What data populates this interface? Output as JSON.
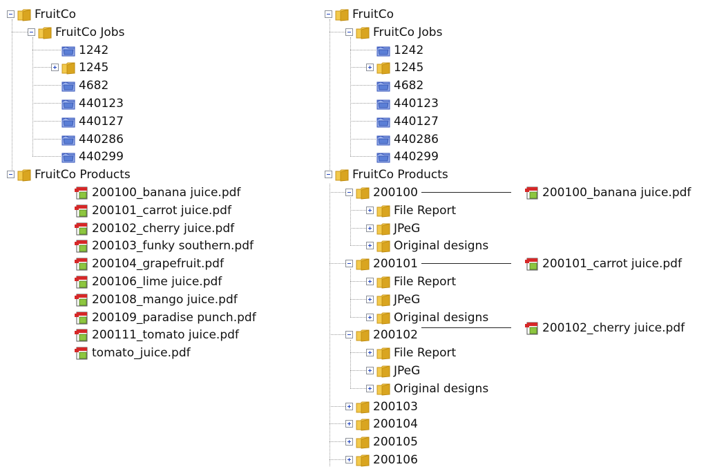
{
  "left_tree": {
    "root": "FruitCo",
    "jobs": {
      "label": "FruitCo Jobs",
      "items": [
        "1242",
        "1245",
        "4682",
        "440123",
        "440127",
        "440286",
        "440299"
      ]
    },
    "products": {
      "label": "FruitCo Products",
      "files": [
        "200100_banana juice.pdf",
        "200101_carrot juice.pdf",
        "200102_cherry juice.pdf",
        "200103_funky southern.pdf",
        "200104_grapefruit.pdf",
        "200106_lime juice.pdf",
        "200108_mango juice.pdf",
        "200109_paradise punch.pdf",
        "200111_tomato juice.pdf",
        "tomato_juice.pdf"
      ]
    }
  },
  "right_tree": {
    "root": "FruitCo",
    "jobs": {
      "label": "FruitCo Jobs",
      "items": [
        "1242",
        "1245",
        "4682",
        "440123",
        "440127",
        "440286",
        "440299"
      ]
    },
    "products": {
      "label": "FruitCo Products",
      "groups": [
        {
          "label": "200100",
          "sub": [
            "File Report",
            "JPeG",
            "Original designs"
          ],
          "file": "200100_banana juice.pdf"
        },
        {
          "label": "200101",
          "sub": [
            "File Report",
            "JPeG",
            "Original designs"
          ],
          "file": "200101_carrot juice.pdf"
        },
        {
          "label": "200102",
          "sub": [
            "File Report",
            "JPeG",
            "Original designs"
          ],
          "file": "200102_cherry juice.pdf"
        }
      ],
      "collapsed": [
        "200103",
        "200104",
        "200105",
        "200106"
      ]
    }
  },
  "colors": {
    "folder": "#f2c94c",
    "folder_dark": "#d9a520",
    "job_folder": "#5b7fd6",
    "pdf_red": "#d62828",
    "pdf_green": "#8dc63f",
    "expander_blue": "#1c3fbd"
  }
}
